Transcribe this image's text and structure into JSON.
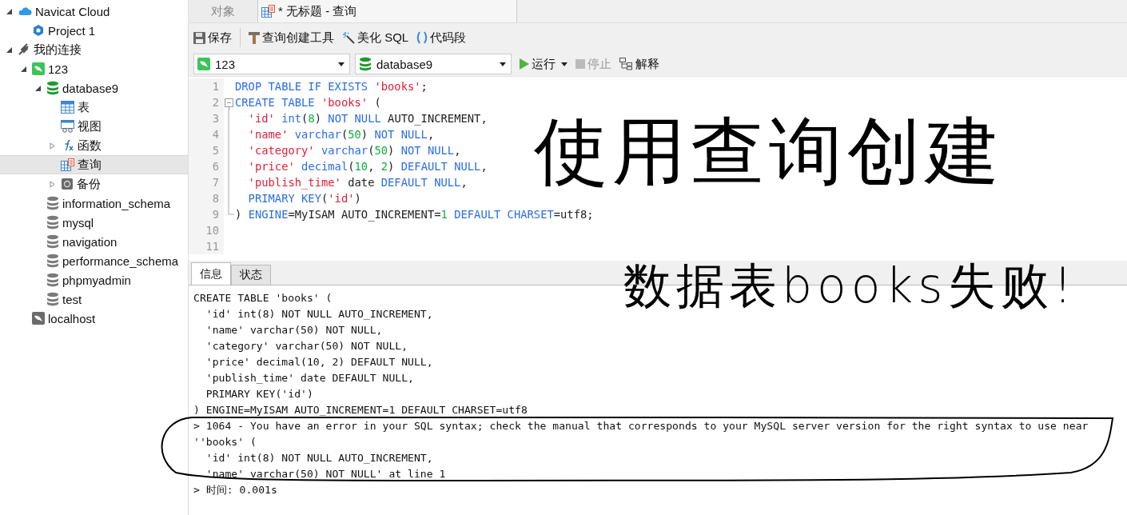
{
  "sidebar": {
    "items": [
      {
        "label": "Navicat Cloud",
        "kind": "cloud",
        "expanded": true,
        "selected": false,
        "children": [
          {
            "label": "Project 1",
            "kind": "project",
            "selected": false
          }
        ]
      },
      {
        "label": "我的连接",
        "kind": "connections",
        "expanded": true,
        "selected": false,
        "children": [
          {
            "label": "123",
            "kind": "mysql",
            "expanded": true,
            "selected": false,
            "children": [
              {
                "label": "database9",
                "kind": "db-open",
                "expanded": true,
                "selected": false,
                "children": [
                  {
                    "label": "表",
                    "kind": "table",
                    "selected": false
                  },
                  {
                    "label": "视图",
                    "kind": "view",
                    "selected": false
                  },
                  {
                    "label": "函数",
                    "kind": "function",
                    "expanded": false,
                    "selected": false
                  },
                  {
                    "label": "查询",
                    "kind": "query",
                    "selected": true
                  },
                  {
                    "label": "备份",
                    "kind": "backup",
                    "expanded": false,
                    "selected": false
                  }
                ]
              },
              {
                "label": "information_schema",
                "kind": "db",
                "selected": false
              },
              {
                "label": "mysql",
                "kind": "db",
                "selected": false
              },
              {
                "label": "navigation",
                "kind": "db",
                "selected": false
              },
              {
                "label": "performance_schema",
                "kind": "db",
                "selected": false
              },
              {
                "label": "phpmyadmin",
                "kind": "db",
                "selected": false
              },
              {
                "label": "test",
                "kind": "db",
                "selected": false
              }
            ]
          },
          {
            "label": "localhost",
            "kind": "mysql-off",
            "selected": false
          }
        ]
      }
    ]
  },
  "tabs": [
    {
      "label": "对象",
      "kind": "plain",
      "selected": false
    },
    {
      "label": "* 无标题 - 查询",
      "kind": "query",
      "selected": true
    }
  ],
  "toolbar": [
    {
      "label": "保存",
      "kind": "save"
    },
    {
      "label": "查询创建工具",
      "kind": "builder"
    },
    {
      "label": "美化 SQL",
      "kind": "beautify"
    },
    {
      "label": "代码段",
      "kind": "snippet"
    }
  ],
  "connection_select": {
    "value": "123"
  },
  "database_select": {
    "value": "database9"
  },
  "run_bar": [
    {
      "label": "运行",
      "kind": "run",
      "disabled": false
    },
    {
      "label": "停止",
      "kind": "stop",
      "disabled": true
    },
    {
      "label": "解释",
      "kind": "explain",
      "disabled": false
    }
  ],
  "editor": {
    "lines": [
      {
        "number": "1",
        "kind": "plain",
        "tokens": [
          {
            "kind": "kw",
            "text": "DROP TABLE IF EXISTS "
          },
          {
            "kind": "str",
            "text": "'books'"
          },
          {
            "kind": "plain",
            "text": ";"
          }
        ]
      },
      {
        "number": "2",
        "kind": "fold-start",
        "tokens": [
          {
            "kind": "kw",
            "text": "CREATE TABLE "
          },
          {
            "kind": "str",
            "text": "'books'"
          },
          {
            "kind": "plain",
            "text": " ("
          }
        ]
      },
      {
        "number": "3",
        "kind": "fold-body",
        "indented": true,
        "tokens": [
          {
            "kind": "str",
            "text": "'id'"
          },
          {
            "kind": "kw",
            "text": " int"
          },
          {
            "kind": "plain",
            "text": "("
          },
          {
            "kind": "num",
            "text": "8"
          },
          {
            "kind": "plain",
            "text": ") "
          },
          {
            "kind": "kw",
            "text": "NOT NULL"
          },
          {
            "kind": "plain",
            "text": " AUTO_INCREMENT,"
          }
        ]
      },
      {
        "number": "4",
        "kind": "fold-body",
        "indented": true,
        "tokens": [
          {
            "kind": "str",
            "text": "'name'"
          },
          {
            "kind": "kw",
            "text": " varchar"
          },
          {
            "kind": "plain",
            "text": "("
          },
          {
            "kind": "num",
            "text": "50"
          },
          {
            "kind": "plain",
            "text": ") "
          },
          {
            "kind": "kw",
            "text": "NOT NULL"
          },
          {
            "kind": "plain",
            "text": ","
          }
        ]
      },
      {
        "number": "5",
        "kind": "fold-body",
        "indented": true,
        "tokens": [
          {
            "kind": "str",
            "text": "'category'"
          },
          {
            "kind": "kw",
            "text": " varchar"
          },
          {
            "kind": "plain",
            "text": "("
          },
          {
            "kind": "num",
            "text": "50"
          },
          {
            "kind": "plain",
            "text": ") "
          },
          {
            "kind": "kw",
            "text": "NOT NULL"
          },
          {
            "kind": "plain",
            "text": ","
          }
        ]
      },
      {
        "number": "6",
        "kind": "fold-body",
        "indented": true,
        "tokens": [
          {
            "kind": "str",
            "text": "'price'"
          },
          {
            "kind": "kw",
            "text": " decimal"
          },
          {
            "kind": "plain",
            "text": "("
          },
          {
            "kind": "num",
            "text": "10"
          },
          {
            "kind": "plain",
            "text": ", "
          },
          {
            "kind": "num",
            "text": "2"
          },
          {
            "kind": "plain",
            "text": ") "
          },
          {
            "kind": "kw",
            "text": "DEFAULT NULL"
          },
          {
            "kind": "plain",
            "text": ","
          }
        ]
      },
      {
        "number": "7",
        "kind": "fold-body",
        "indented": true,
        "tokens": [
          {
            "kind": "str",
            "text": "'publish_time'"
          },
          {
            "kind": "plain",
            "text": " date "
          },
          {
            "kind": "kw",
            "text": "DEFAULT NULL"
          },
          {
            "kind": "plain",
            "text": ","
          }
        ]
      },
      {
        "number": "8",
        "kind": "fold-body",
        "indented": true,
        "tokens": [
          {
            "kind": "kw",
            "text": "PRIMARY KEY"
          },
          {
            "kind": "plain",
            "text": "("
          },
          {
            "kind": "str",
            "text": "'id'"
          },
          {
            "kind": "plain",
            "text": ")"
          }
        ]
      },
      {
        "number": "9",
        "kind": "fold-end",
        "tokens": [
          {
            "kind": "plain",
            "text": ") "
          },
          {
            "kind": "kw",
            "text": "ENGINE"
          },
          {
            "kind": "plain",
            "text": "=MyISAM AUTO_INCREMENT="
          },
          {
            "kind": "num",
            "text": "1"
          },
          {
            "kind": "kw",
            "text": " DEFAULT CHARSET"
          },
          {
            "kind": "plain",
            "text": "=utf8;"
          }
        ]
      },
      {
        "number": "10",
        "kind": "plain"
      },
      {
        "number": "11",
        "kind": "plain"
      }
    ]
  },
  "result_tabs": [
    {
      "label": "信息",
      "selected": true
    },
    {
      "label": "状态",
      "selected": false
    }
  ],
  "messages": [
    "CREATE TABLE 'books' (",
    "  'id' int(8) NOT NULL AUTO_INCREMENT,",
    "  'name' varchar(50) NOT NULL,",
    "  'category' varchar(50) NOT NULL,",
    "  'price' decimal(10, 2) DEFAULT NULL,",
    "  'publish_time' date DEFAULT NULL,",
    "  PRIMARY KEY('id')",
    ") ENGINE=MyISAM AUTO_INCREMENT=1 DEFAULT CHARSET=utf8",
    "> 1064 - You have an error in your SQL syntax; check the manual that corresponds to your MySQL server version for the right syntax to use near",
    "''books' (",
    "  'id' int(8) NOT NULL AUTO_INCREMENT,",
    "  'name' varchar(50) NOT NULL' at line 1",
    "> 时间: 0.001s"
  ],
  "annotation": {
    "lines": [
      "使用查询创建",
      "数据表books失败!"
    ]
  }
}
